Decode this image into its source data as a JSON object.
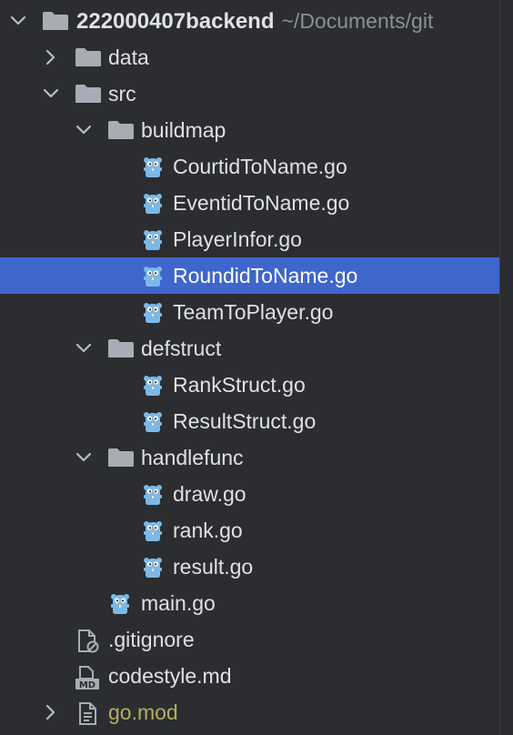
{
  "tree": {
    "root": {
      "name": "222000407backend",
      "path": "~/Documents/git"
    },
    "data_folder": "data",
    "src_folder": "src",
    "buildmap": {
      "name": "buildmap",
      "files": [
        "CourtidToName.go",
        "EventidToName.go",
        "PlayerInfor.go",
        "RoundidToName.go",
        "TeamToPlayer.go"
      ]
    },
    "defstruct": {
      "name": "defstruct",
      "files": [
        "RankStruct.go",
        "ResultStruct.go"
      ]
    },
    "handlefunc": {
      "name": "handlefunc",
      "files": [
        "draw.go",
        "rank.go",
        "result.go"
      ]
    },
    "main_file": "main.go",
    "gitignore": ".gitignore",
    "codestyle": "codestyle.md",
    "md_badge": "MD",
    "gomod": "go.mod",
    "selected_file": "RoundidToName.go"
  },
  "colors": {
    "background": "#2b2d30",
    "selection": "#3f66cc",
    "text": "#dfe1e5",
    "path_text": "#8c8f94",
    "gomod_text": "#b3ae60",
    "folder_icon": "#a8adb5",
    "gopher": "#7bb9e8"
  },
  "icons": {
    "folder": "folder-icon",
    "go_file": "gopher-icon",
    "ignored_file": "ignored-file-icon",
    "markdown_file": "markdown-icon",
    "text_file": "text-file-icon",
    "expand": "chevron-right-icon",
    "collapse": "chevron-down-icon"
  }
}
